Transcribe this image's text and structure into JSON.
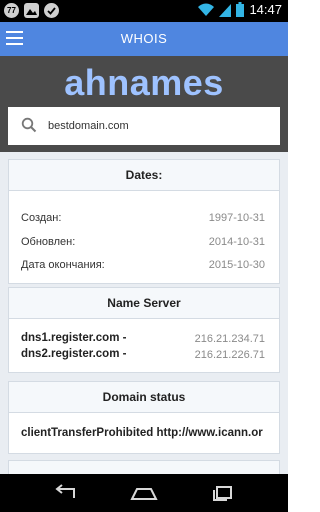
{
  "status_bar": {
    "time": "14:47",
    "left_icons": [
      "nfc-icon",
      "image-icon",
      "check-icon"
    ],
    "right_icons": [
      "wifi-icon",
      "signal-icon",
      "battery-icon"
    ]
  },
  "app_bar": {
    "title": "WHOIS",
    "menu_icon": "hamburger-menu-icon"
  },
  "hero": {
    "logo": "ahnames",
    "logo_color": "#9ec2ff"
  },
  "search": {
    "value": "bestdomain.com",
    "icon": "search-icon"
  },
  "dates": {
    "title": "Dates:",
    "rows": [
      {
        "label": "Создан:",
        "value": "1997-10-31"
      },
      {
        "label": "Обновлен:",
        "value": "2014-10-31"
      },
      {
        "label": "Дата окончания:",
        "value": "2015-10-30"
      }
    ]
  },
  "name_server": {
    "title": "Name Server",
    "rows": [
      {
        "host": "dns1.register.com -",
        "ip": "216.21.234.71"
      },
      {
        "host": "dns2.register.com -",
        "ip": "216.21.226.71"
      }
    ]
  },
  "domain_status": {
    "title": "Domain status",
    "value": "clientTransferProhibited http://www.icann.or"
  },
  "colors": {
    "app_bar": "#4f86e0",
    "hero_bg": "#4a4a4a",
    "content_bg": "#e9edf2"
  },
  "nav_bar": {
    "icons": [
      "back-icon",
      "home-icon",
      "recent-apps-icon"
    ]
  }
}
